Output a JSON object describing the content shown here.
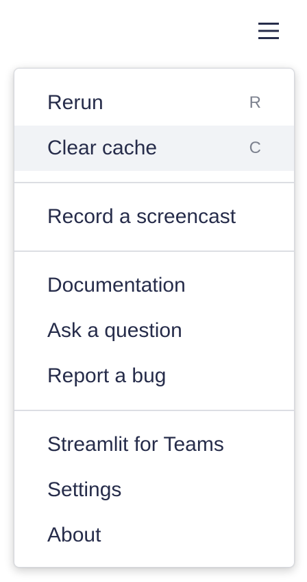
{
  "header": {
    "menu_icon": "hamburger-menu-icon"
  },
  "menu": {
    "groups": [
      {
        "items": [
          {
            "label": "Rerun",
            "shortcut": "R"
          },
          {
            "label": "Clear cache",
            "shortcut": "C"
          }
        ]
      },
      {
        "items": [
          {
            "label": "Record a screencast"
          }
        ]
      },
      {
        "items": [
          {
            "label": "Documentation"
          },
          {
            "label": "Ask a question"
          },
          {
            "label": "Report a bug"
          }
        ]
      },
      {
        "items": [
          {
            "label": "Streamlit for Teams"
          },
          {
            "label": "Settings"
          },
          {
            "label": "About"
          }
        ]
      }
    ]
  },
  "colors": {
    "text": "#262c4a",
    "shortcut": "#7c818e",
    "hover_bg": "#f1f3f6",
    "divider": "#dcdee3"
  }
}
